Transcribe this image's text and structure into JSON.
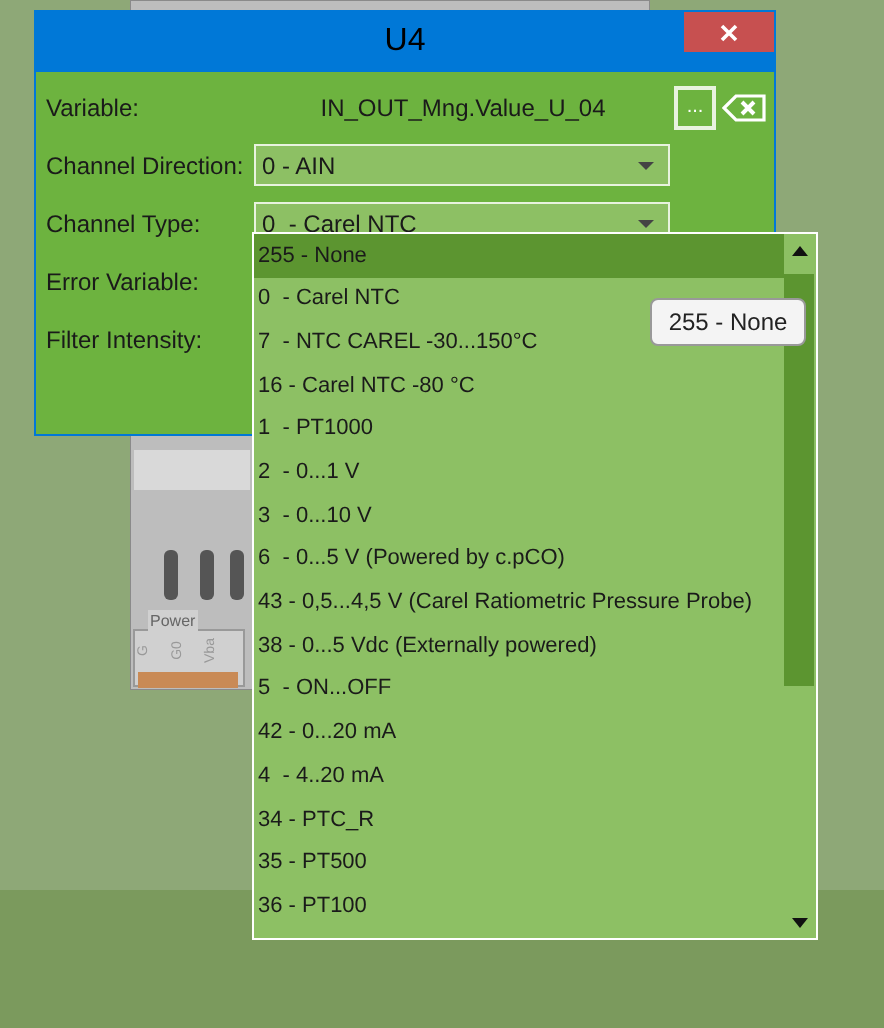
{
  "window": {
    "title": "U4"
  },
  "fields": [
    {
      "label": "Variable:",
      "kind": "variable",
      "value": "IN_OUT_Mng.Value_U_04",
      "browse": "..."
    },
    {
      "label": "Channel Direction:",
      "kind": "dropdown",
      "value": "0 - AIN"
    },
    {
      "label": "Channel Type:",
      "kind": "dropdown",
      "value": "0  - Carel NTC"
    },
    {
      "label": "Error Variable:",
      "kind": "label"
    },
    {
      "label": "Filter Intensity:",
      "kind": "label"
    }
  ],
  "dropdown_list": [
    {
      "label": "255 - None",
      "selected": true
    },
    {
      "label": "0  - Carel NTC",
      "selected": false
    },
    {
      "label": "7  - NTC CAREL -30...150°C",
      "selected": false
    },
    {
      "label": "16 - Carel NTC -80 °C",
      "selected": false
    },
    {
      "label": "1  - PT1000",
      "selected": false
    },
    {
      "label": "2  - 0...1 V",
      "selected": false
    },
    {
      "label": "3  - 0...10 V",
      "selected": false
    },
    {
      "label": "6  - 0...5 V (Powered by c.pCO)",
      "selected": false
    },
    {
      "label": "43 - 0,5...4,5 V (Carel Ratiometric Pressure Probe)",
      "selected": false
    },
    {
      "label": "38 - 0...5 Vdc (Externally powered)",
      "selected": false
    },
    {
      "label": "5  - ON...OFF",
      "selected": false
    },
    {
      "label": "42 - 0...20 mA",
      "selected": false
    },
    {
      "label": "4  - 4..20 mA",
      "selected": false
    },
    {
      "label": "34 - PTC_R",
      "selected": false
    },
    {
      "label": "35 - PT500",
      "selected": false
    },
    {
      "label": "36 - PT100",
      "selected": false
    }
  ],
  "tooltip": "255 - None",
  "device": {
    "group_label": "Power",
    "terminals": [
      "G",
      "G0",
      "Vba"
    ]
  }
}
